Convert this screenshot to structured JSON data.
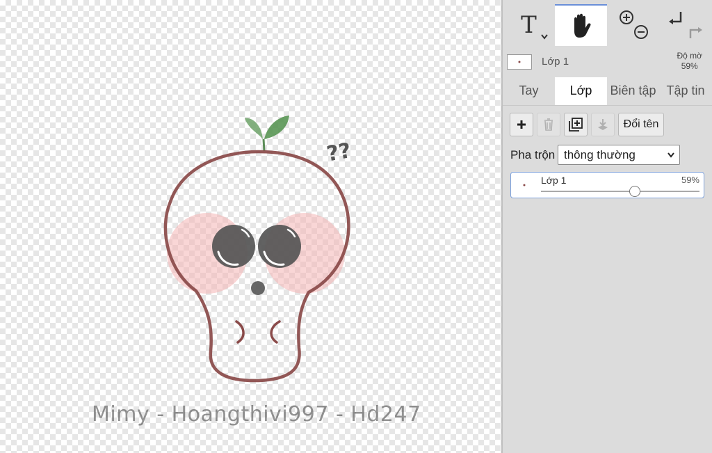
{
  "canvas": {
    "caption": "Mimy - Hoangthivi997 - Hd247",
    "question_marks": "??",
    "colors": {
      "outline": "#8a4a49",
      "blush": "#f4b4b4",
      "eye": "#555555",
      "leaf": "#4f8f4a"
    }
  },
  "toolbar": {
    "text_tool_glyph": "T",
    "icons": [
      "text-tool-icon",
      "hand-tool-icon",
      "zoom-in-icon",
      "zoom-out-icon",
      "undo-icon",
      "redo-icon"
    ],
    "active_tool": "hand"
  },
  "layer_info": {
    "name": "Lớp 1",
    "opacity_label": "Độ mờ",
    "opacity_value": "59%"
  },
  "tabs": {
    "hand": "Tay",
    "layer": "Lớp",
    "edit": "Biên tập",
    "file": "Tập tin",
    "active": "layer"
  },
  "actions": {
    "rename_label": "Đổi tên"
  },
  "blend": {
    "label": "Pha trộn",
    "value": "thông thường"
  },
  "layer_row": {
    "name": "Lớp 1",
    "opacity": "59%",
    "opacity_fraction": 0.59
  }
}
